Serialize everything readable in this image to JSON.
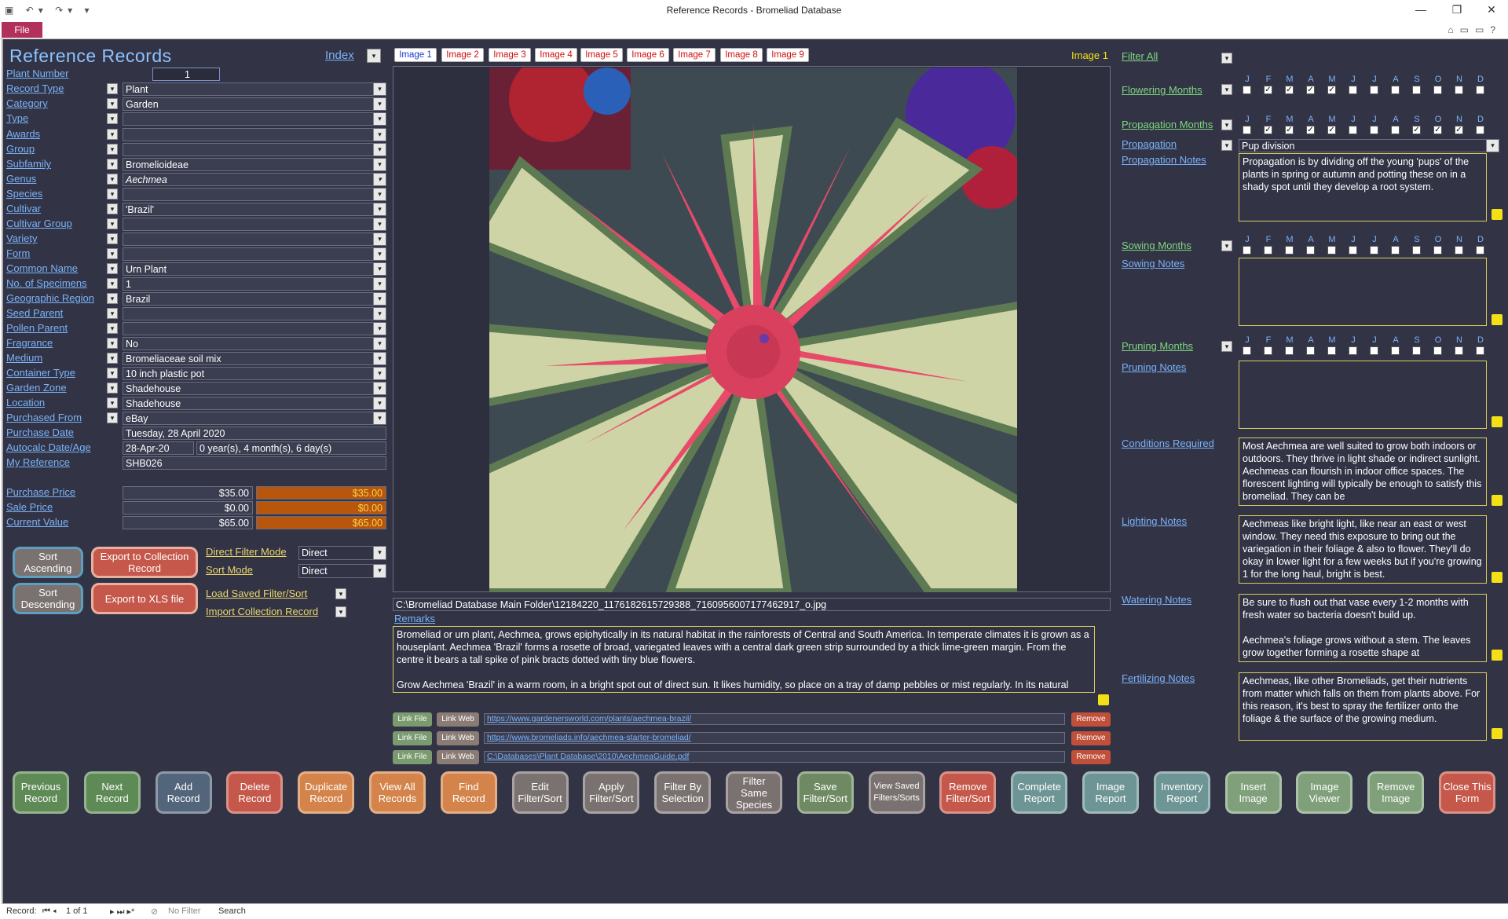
{
  "window": {
    "title": "Reference Records  -  Bromeliad Database",
    "file_tab": "File"
  },
  "header": {
    "title": "Reference Records",
    "index_label": "Index"
  },
  "fields": [
    {
      "label": "Plant Number",
      "value": "1"
    },
    {
      "label": "Record Type",
      "value": "Plant"
    },
    {
      "label": "Category",
      "value": "Garden"
    },
    {
      "label": "Type",
      "value": ""
    },
    {
      "label": "Awards",
      "value": ""
    },
    {
      "label": "Group",
      "value": ""
    },
    {
      "label": "Subfamily",
      "value": "Bromelioideae"
    },
    {
      "label": "Genus",
      "value": "Aechmea"
    },
    {
      "label": "Species",
      "value": ""
    },
    {
      "label": "Cultivar",
      "value": "'Brazil'"
    },
    {
      "label": "Cultivar Group",
      "value": ""
    },
    {
      "label": "Variety",
      "value": ""
    },
    {
      "label": "Form",
      "value": ""
    },
    {
      "label": "Common Name",
      "value": "Urn Plant"
    },
    {
      "label": "No. of Specimens",
      "value": "1"
    },
    {
      "label": "Geographic Region",
      "value": "Brazil"
    },
    {
      "label": "Seed Parent",
      "value": ""
    },
    {
      "label": "Pollen Parent",
      "value": ""
    },
    {
      "label": "Fragrance",
      "value": "No"
    },
    {
      "label": "Medium",
      "value": "Bromeliaceae soil mix"
    },
    {
      "label": "Container Type",
      "value": "10 inch plastic pot"
    },
    {
      "label": "Garden Zone",
      "value": "Shadehouse"
    },
    {
      "label": "Location",
      "value": "Shadehouse"
    },
    {
      "label": "Purchased From",
      "value": "eBay"
    },
    {
      "label": "Purchase Date",
      "value": "Tuesday, 28 April 2020"
    },
    {
      "label": "Autocalc Date/Age",
      "value": "28-Apr-20",
      "value2": "0 year(s), 4 month(s), 6 day(s)"
    },
    {
      "label": "My Reference",
      "value": "SHB026"
    }
  ],
  "prices": [
    {
      "label": "Purchase Price",
      "value": "$35.00",
      "value2": "$35.00"
    },
    {
      "label": "Sale Price",
      "value": "$0.00",
      "value2": "$0.00"
    },
    {
      "label": "Current Value",
      "value": "$65.00",
      "value2": "$65.00"
    }
  ],
  "side_buttons": {
    "sort_asc": "Sort Ascending",
    "sort_desc": "Sort Descending",
    "export_collection": "Export to Collection Record",
    "export_xls": "Export to XLS file"
  },
  "modes": {
    "direct_filter_label": "Direct Filter Mode",
    "direct_filter_value": "Direct",
    "sort_mode_label": "Sort Mode",
    "sort_mode_value": "Direct",
    "load_saved": "Load Saved Filter/Sort",
    "import_collection": "Import Collection Record"
  },
  "image_tabs": [
    "Image 1",
    "Image 2",
    "Image 3",
    "Image 4",
    "Image 5",
    "Image 6",
    "Image 7",
    "Image 8",
    "Image 9"
  ],
  "current_image_label": "Image 1",
  "image_path": "C:\\Bromeliad Database Main Folder\\12184220_1176182615729388_7160956007177462917_o.jpg",
  "remarks": {
    "label": "Remarks",
    "text1": "Bromeliad or urn plant, Aechmea, grows epiphytically in its natural habitat in the rainforests of Central and South America. In temperate climates it is grown as a houseplant. Aechmea 'Brazil' forms a rosette of broad, variegated leaves with a central dark green strip surrounded by a thick lime-green margin. From the centre it bears a tall spike of pink bracts dotted with tiny blue flowers.",
    "text2": "Grow Aechmea 'Brazil' in a warm room, in a bright spot out of direct sun. It likes humidity, so place on a tray of damp pebbles or mist regularly. In its natural habitat the rosette of leaves form an 'urn' or well, which collects rainwater. As a houseplant, the plant is watered by filling the urn, too, to"
  },
  "links": [
    {
      "file": "Link File",
      "web": "Link Web",
      "url": "https://www.gardenersworld.com/plants/aechmea-brazil/",
      "remove": "Remove"
    },
    {
      "file": "Link File",
      "web": "Link Web",
      "url": "https://www.bromeliads.info/aechmea-starter-bromeliad/",
      "remove": "Remove"
    },
    {
      "file": "Link File",
      "web": "Link Web",
      "url": "C:\\Databases\\Plant Database\\2010\\AechmeaGuide.pdf",
      "remove": "Remove"
    }
  ],
  "right": {
    "filter_all": "Filter All",
    "months_letters": [
      "J",
      "F",
      "M",
      "A",
      "M",
      "J",
      "J",
      "A",
      "S",
      "O",
      "N",
      "D"
    ],
    "flowering_label": "Flowering Months",
    "flowering_checked": [
      false,
      true,
      true,
      true,
      true,
      false,
      false,
      false,
      false,
      false,
      false,
      false
    ],
    "propagation_months_label": "Propagation Months",
    "propagation_checked": [
      false,
      true,
      true,
      true,
      true,
      false,
      false,
      false,
      true,
      true,
      true,
      false
    ],
    "propagation_label": "Propagation",
    "propagation_value": "Pup division",
    "propagation_notes_label": "Propagation Notes",
    "propagation_notes": "Propagation is by dividing off the young 'pups' of the plants in spring or autumn and potting these on in a shady spot until they develop a root system.",
    "sowing_label": "Sowing Months",
    "sowing_notes_label": "Sowing Notes",
    "sowing_notes": "",
    "pruning_label": "Pruning Months",
    "pruning_notes_label": "Pruning Notes",
    "pruning_notes": "",
    "conditions_label": "Conditions Required",
    "conditions": "Most Aechmea are well suited to grow both indoors or outdoors. They thrive in light shade or indirect sunlight. Aechmeas can flourish in indoor office spaces. The florescent lighting will typically be enough to satisfy this bromeliad. They can be",
    "lighting_label": "Lighting Notes",
    "lighting": "Aechmeas like bright light, like near an east or west window. They need this exposure to bring out the variegation in their foliage & also to flower. They'll do okay in lower light for a few weeks but if you're growing 1 for the long haul, bright is best.",
    "watering_label": "Watering Notes",
    "watering1": "Be sure to flush out that vase every 1-2 months with fresh water so bacteria doesn't build up.",
    "watering2": "Aechmea's foliage grows without a stem. The leaves grow together forming a rosette shape at",
    "fertilizing_label": "Fertilizing Notes",
    "fertilizing": "Aechmeas, like other Bromeliads, get their nutrients from matter which falls on them from plants above. For this reason, it's best to spray the fertilizer onto the foliage & the surface of the growing medium."
  },
  "bottom_buttons": [
    {
      "label": "Previous Record",
      "color": "#5e8a55"
    },
    {
      "label": "Next Record",
      "color": "#5e8a55"
    },
    {
      "label": "Add Record",
      "color": "#52657a"
    },
    {
      "label": "Delete Record",
      "color": "#c5584a"
    },
    {
      "label": "Duplicate Record",
      "color": "#d4844a"
    },
    {
      "label": "View All Records",
      "color": "#d4844a"
    },
    {
      "label": "Find Record",
      "color": "#d4844a"
    },
    {
      "label": "Edit Filter/Sort",
      "color": "#7a7270"
    },
    {
      "label": "Apply Filter/Sort",
      "color": "#7a7270"
    },
    {
      "label": "Filter By Selection",
      "color": "#7a7270"
    },
    {
      "label": "Filter Same Species",
      "color": "#7a7270"
    },
    {
      "label": "Save Filter/Sort",
      "color": "#6f8a62"
    },
    {
      "label": "View Saved Filters/Sorts",
      "color": "#7a7270"
    },
    {
      "label": "Remove Filter/Sort",
      "color": "#c5584a"
    },
    {
      "label": "Complete Report",
      "color": "#6e9595"
    },
    {
      "label": "Image Report",
      "color": "#6e9595"
    },
    {
      "label": "Inventory Report",
      "color": "#6e9595"
    },
    {
      "label": "Insert Image",
      "color": "#7fa07a"
    },
    {
      "label": "Image Viewer",
      "color": "#7fa07a"
    },
    {
      "label": "Remove Image",
      "color": "#7fa07a"
    },
    {
      "label": "Close This Form",
      "color": "#c5584a"
    }
  ],
  "status": {
    "record_label": "Record:",
    "record_pos": "1 of 1",
    "filter": "No Filter",
    "search": "Search"
  }
}
